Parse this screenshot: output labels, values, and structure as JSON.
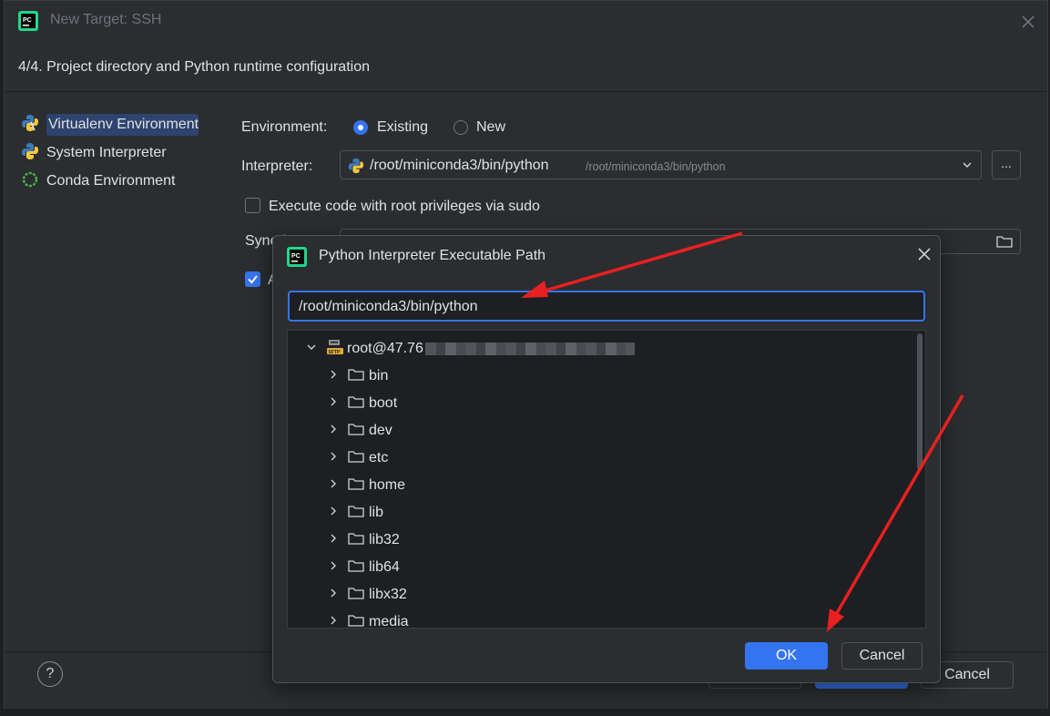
{
  "outer_dialog": {
    "title": "New Target: SSH",
    "step": "4/4. Project directory and Python runtime configuration",
    "nav": [
      {
        "label": "Virtualenv Environment",
        "icon": "python-virtualenv-icon",
        "selected": true
      },
      {
        "label": "System Interpreter",
        "icon": "python-icon",
        "selected": false
      },
      {
        "label": "Conda Environment",
        "icon": "conda-icon",
        "selected": false
      }
    ],
    "environment_label": "Environment:",
    "env_existing": "Existing",
    "env_new": "New",
    "interpreter_label": "Interpreter:",
    "interpreter_value": "/root/miniconda3/bin/python",
    "interpreter_hint": "/root/miniconda3/bin/python",
    "browse_label": "...",
    "sudo_label": "Execute code with root privileges via sudo",
    "sync_label_partial": "Sync f",
    "auto_label_partial": "A",
    "help_label": "?",
    "cancel_label": "Cancel"
  },
  "inner_dialog": {
    "title": "Python Interpreter Executable Path",
    "path_value": "/root/miniconda3/bin/python",
    "tree_root": "root@47.76",
    "tree_items": [
      "bin",
      "boot",
      "dev",
      "etc",
      "home",
      "lib",
      "lib32",
      "lib64",
      "libx32",
      "media"
    ],
    "ok_label": "OK",
    "cancel_label": "Cancel"
  },
  "colors": {
    "accent": "#3574f0",
    "background": "#2b2d30",
    "annotation_arrow": "#e8201f"
  }
}
